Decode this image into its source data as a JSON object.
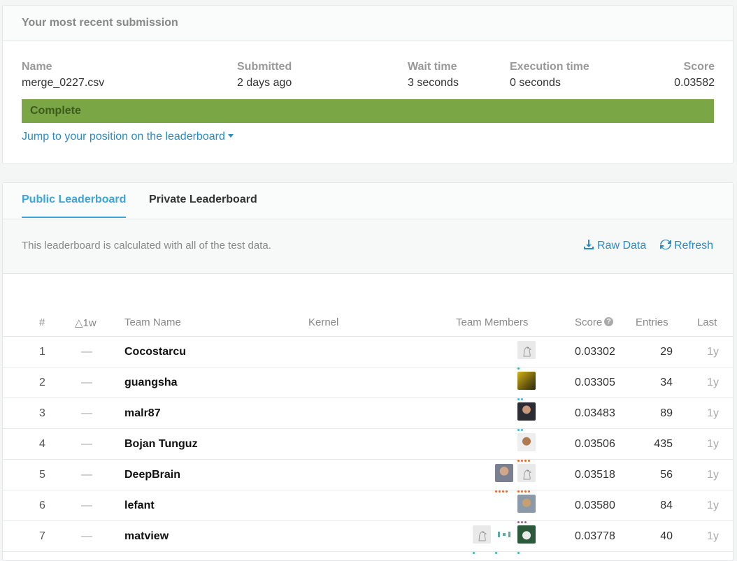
{
  "submission": {
    "header": "Your most recent submission",
    "columns": {
      "name": {
        "label": "Name",
        "value": "merge_0227.csv"
      },
      "submitted": {
        "label": "Submitted",
        "value": "2 days ago"
      },
      "wait": {
        "label": "Wait time",
        "value": "3 seconds"
      },
      "execution": {
        "label": "Execution time",
        "value": "0 seconds"
      },
      "score": {
        "label": "Score",
        "value": "0.03582"
      }
    },
    "status": "Complete",
    "status_color": "#7aa645",
    "jump_link": "Jump to your position on the leaderboard"
  },
  "leaderboard": {
    "tabs": [
      "Public Leaderboard",
      "Private Leaderboard"
    ],
    "active_tab": "Public Leaderboard",
    "info": "This leaderboard is calculated with all of the test data.",
    "actions": {
      "raw_data": "Raw Data",
      "refresh": "Refresh"
    },
    "headers": {
      "rank": "#",
      "delta": "△1w",
      "team": "Team Name",
      "kernel": "Kernel",
      "members": "Team Members",
      "score": "Score",
      "entries": "Entries",
      "last": "Last"
    },
    "rows": [
      {
        "rank": "1",
        "delta": "—",
        "team": "Cocostarcu",
        "score": "0.03302",
        "entries": "29",
        "last": "1y"
      },
      {
        "rank": "2",
        "delta": "—",
        "team": "guangsha",
        "score": "0.03305",
        "entries": "34",
        "last": "1y"
      },
      {
        "rank": "3",
        "delta": "—",
        "team": "malr87",
        "score": "0.03483",
        "entries": "89",
        "last": "1y"
      },
      {
        "rank": "4",
        "delta": "—",
        "team": "Bojan Tunguz",
        "score": "0.03506",
        "entries": "435",
        "last": "1y"
      },
      {
        "rank": "5",
        "delta": "—",
        "team": "DeepBrain",
        "score": "0.03518",
        "entries": "56",
        "last": "1y"
      },
      {
        "rank": "6",
        "delta": "—",
        "team": "lefant",
        "score": "0.03580",
        "entries": "84",
        "last": "1y"
      },
      {
        "rank": "7",
        "delta": "—",
        "team": "matview",
        "score": "0.03778",
        "entries": "40",
        "last": "1y"
      }
    ]
  },
  "colors": {
    "accent": "#3ba5d9",
    "link": "#2a8bc2"
  }
}
